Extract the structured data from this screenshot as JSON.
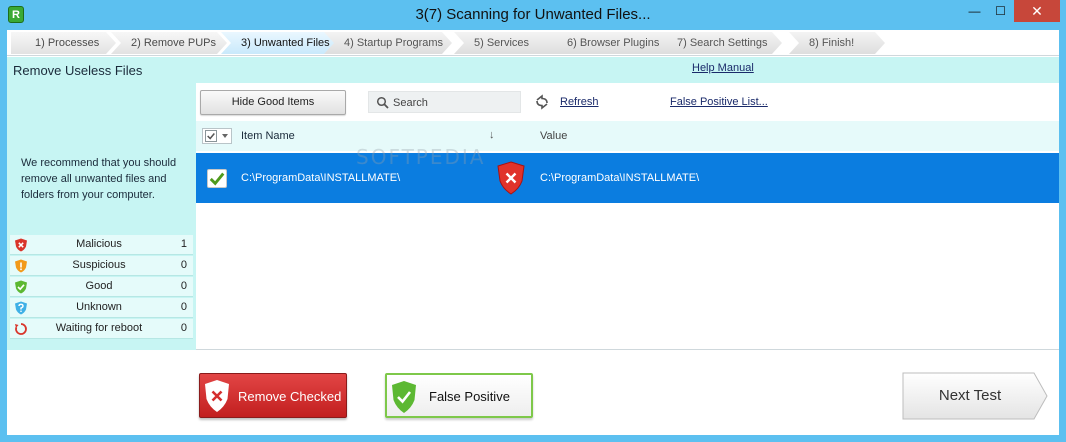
{
  "window": {
    "app_icon": "R",
    "title": "3(7) Scanning for Unwanted Files...",
    "minimize": "—",
    "maximize": "☐",
    "close": "✕"
  },
  "wizard": {
    "steps": [
      {
        "label": "1) Processes",
        "state": "done"
      },
      {
        "label": "2) Remove PUPs",
        "state": "done"
      },
      {
        "label": "3) Unwanted Files",
        "state": "active"
      },
      {
        "label": "4) Startup Programs",
        "state": "pending"
      },
      {
        "label": "5) Services",
        "state": "pending"
      },
      {
        "label": "6) Browser Plugins",
        "state": "pending"
      },
      {
        "label": "7) Search Settings",
        "state": "pending"
      },
      {
        "label": "8) Finish!",
        "state": "pending"
      }
    ]
  },
  "subheader": {
    "title": "Remove Useless Files",
    "help_link": "Help Manual"
  },
  "left_panel": {
    "recommendation": "We recommend that you should remove all unwanted files and folders from your computer.",
    "stats": [
      {
        "label": "Malicious",
        "count": "1",
        "icon": "malicious-shield-icon",
        "color": "#d9352b"
      },
      {
        "label": "Suspicious",
        "count": "0",
        "icon": "suspicious-shield-icon",
        "color": "#f29a1a"
      },
      {
        "label": "Good",
        "count": "0",
        "icon": "good-shield-icon",
        "color": "#5cb832"
      },
      {
        "label": "Unknown",
        "count": "0",
        "icon": "unknown-shield-icon",
        "color": "#3fb0e6"
      },
      {
        "label": "Waiting for reboot",
        "count": "0",
        "icon": "reboot-icon",
        "color": "#d9352b"
      }
    ]
  },
  "toolbar": {
    "hide_good_label": "Hide Good Items",
    "search_placeholder": "Search",
    "refresh_label": "Refresh",
    "false_positive_list_label": "False Positive List..."
  },
  "table": {
    "columns": [
      "Item Name",
      "Value"
    ],
    "sort_indicator": "↓",
    "rows": [
      {
        "checked": true,
        "item_name": "C:\\ProgramData\\INSTALLMATE\\",
        "status": "malicious",
        "value": "C:\\ProgramData\\INSTALLMATE\\"
      }
    ]
  },
  "actions": {
    "remove_checked": "Remove Checked",
    "false_positive": "False Positive",
    "next_test": "Next Test"
  },
  "watermark": "SOFTPEDIA",
  "colors": {
    "titlebar": "#5cc0f0",
    "panel_bg": "#c7f5f3",
    "selected_row": "#0b7de0",
    "remove_button": "#d42e2e",
    "false_positive_border": "#7ec84a"
  }
}
